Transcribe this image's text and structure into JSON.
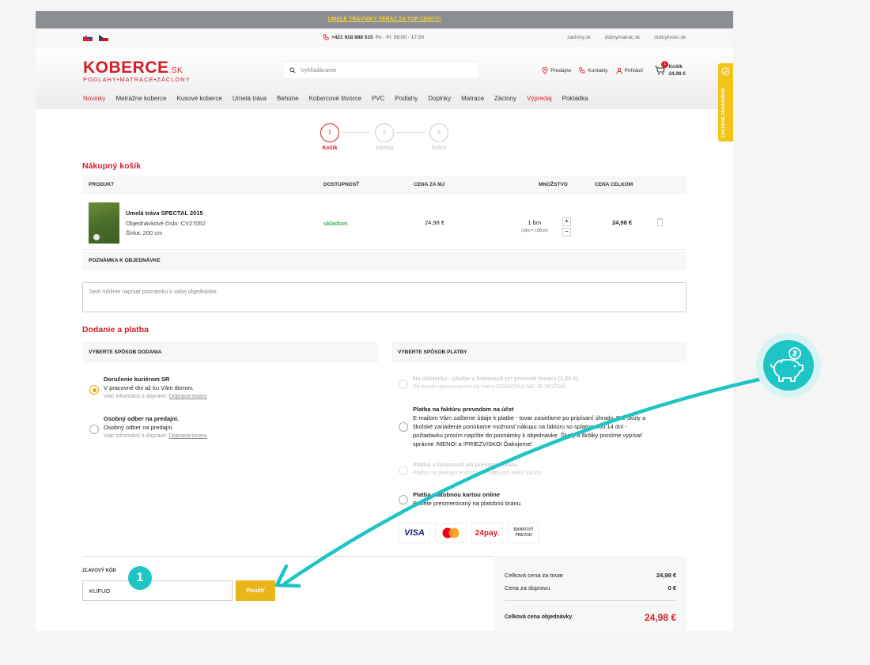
{
  "promo_text": "UMELÉ TRÁVNIKY TERAZ ZA TOP CENY!!!",
  "topbar": {
    "phone_number": "+421 918 888 515",
    "phone_hours": "Po - Pi: 09:00 - 17:00",
    "links": [
      "zaclony.sk",
      "dobrymatrac.sk",
      "dobrylovec.sk"
    ]
  },
  "header": {
    "logo_main": "KOBERCE",
    "logo_tld": ".SK",
    "logo_sub": "PODLAHY•MATRACE•ZÁCLONY",
    "search_placeholder": "Vyhľadávanie",
    "stores": "Predajne",
    "contacts": "Kontakty",
    "login": "Prihlásiť",
    "cart_label": "Košík",
    "cart_total": "24,98 €",
    "cart_count": "1"
  },
  "nav": [
    "Novinky",
    "Metrážne koberce",
    "Kusové koberce",
    "Umelá tráva",
    "Behúne",
    "Kobercové štvorce",
    "PVC",
    "Podlahy",
    "Doplnky",
    "Matrace",
    "Záclony",
    "Výpredaj",
    "Pokládka"
  ],
  "steps": [
    {
      "num": "1",
      "label": "Košík"
    },
    {
      "num": "2",
      "label": "Adresa"
    },
    {
      "num": "3",
      "label": "Súhrn"
    }
  ],
  "cart": {
    "heading": "Nákupný košík",
    "columns": [
      "PRODUKT",
      "DOSTUPNOSŤ",
      "CENA ZA MJ",
      "MNOŽSTVO",
      "CENA CELKOM"
    ],
    "item": {
      "name": "Umelá tráva SPECTAL 2015",
      "order_no": "Objednávkové číslo: CV27052",
      "width": "Šírka: 200 cm",
      "availability": "skladom",
      "unit_price": "24,98 €",
      "quantity": "1 bm",
      "quantity_note": "(1bm = 100cm)",
      "plus": "+",
      "minus": "−",
      "total": "24,98 €"
    }
  },
  "note": {
    "heading": "POZNÁMKA K OBJEDNÁVKE",
    "placeholder": "Sem môžete napísať poznámku k vašej objednávke."
  },
  "delivery": {
    "heading": "Dodanie a platba",
    "shipping_heading": "VYBERTE SPÔSOB DODANIA",
    "payment_heading": "VYBERTE SPÔSOB PLATBY",
    "shipping_options": [
      {
        "title": "Doručenie kuriérom SR",
        "desc": "V pracovné dni až ku Vám domov.",
        "meta": "Viac informácií o doprave:",
        "link": "Doprava tovaru"
      },
      {
        "title": "Osobný odber na predajni.",
        "desc": "Osobný odber na predajni.",
        "meta": "Viac informácií o doprave:",
        "link": "Doprava tovaru"
      }
    ],
    "payment_options": [
      {
        "title": "Na dobierku - platba v hotovosti pri prevzatí tovaru (1,50 €)",
        "desc": "Pri tovare upravovanom na mieru DOBIERKA NIE JE MOŽNÁ!"
      },
      {
        "title": "Platba na faktúru prevodom na účet",
        "desc1": "E-mailom Vám zašleme údaje k platbe - tovar zasielame po pripísaní úhrady. Pre školy a",
        "desc2": "školské zariadenie ponúkame možnosť nákupu na faktúru so splatnosťou 14 dní -",
        "desc3": "požiadavku prosím napíšte do poznámky k objednávke. Školy a škôlky prosíme vypísať",
        "desc4": "správne !MENO! a !PRIEZVISKO! Ďakujeme!"
      },
      {
        "title": "Platba v hotovosti pri prevzatí tovaru.",
        "desc": "Platba na predajni je možná v hotovosti alebo kartou."
      },
      {
        "title": "Platba platobnou kartou online",
        "desc": "Budete presmerovaný na platobnú bránu."
      }
    ],
    "pay_logos": [
      "VISA",
      "mastercard",
      "24pay.",
      "BANKOVÝ PREVOD"
    ]
  },
  "coupon": {
    "label": "ZĽAVOVÝ KÓD",
    "value": "KUFUO",
    "apply": "Použiť",
    "step_badge": "1"
  },
  "summary": {
    "goods_label": "Celková cena za tovar",
    "goods_value": "24,98 €",
    "shipping_label": "Cena za dopravu",
    "shipping_value": "0 €",
    "total_label": "Celková cena objednávky",
    "total_value": "24,98 €"
  },
  "side_tab": "OVERENÉ ZÁKAZNÍKMI",
  "colors": {
    "brand_red": "#d21f2a",
    "accent_yellow": "#e8b61a",
    "teal": "#1fc4c4",
    "stock_green": "#3bb34a"
  }
}
